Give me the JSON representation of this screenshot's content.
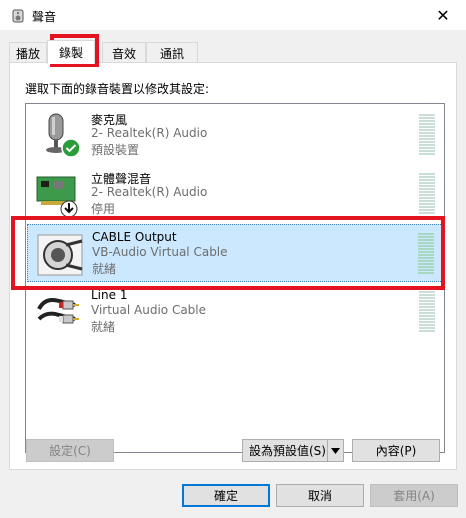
{
  "window": {
    "title": "聲音",
    "close_label": "✕"
  },
  "tabs": [
    {
      "label": "播放"
    },
    {
      "label": "錄製"
    },
    {
      "label": "音效"
    },
    {
      "label": "通訊"
    }
  ],
  "instruction": "選取下面的錄音裝置以修改其設定:",
  "devices": [
    {
      "name": "麥克風",
      "description": "2- Realtek(R) Audio",
      "status": "預設裝置",
      "icon": "microphone-icon"
    },
    {
      "name": "立體聲混音",
      "description": "2- Realtek(R) Audio",
      "status": "停用",
      "icon": "sound-card-icon"
    },
    {
      "name": "CABLE Output",
      "description": "VB-Audio Virtual Cable",
      "status": "就緒",
      "icon": "virtual-cable-icon"
    },
    {
      "name": "Line 1",
      "description": "Virtual Audio Cable",
      "status": "就緒",
      "icon": "rca-cable-icon"
    }
  ],
  "buttons": {
    "configure": "設定(C)",
    "set_default": "設為預設值(S)",
    "properties": "內容(P)",
    "ok": "確定",
    "cancel": "取消",
    "apply": "套用(A)"
  },
  "colors": {
    "selection": "#cce8ff",
    "highlight_box": "#e3141f",
    "default_check": "#2a9d3a"
  }
}
